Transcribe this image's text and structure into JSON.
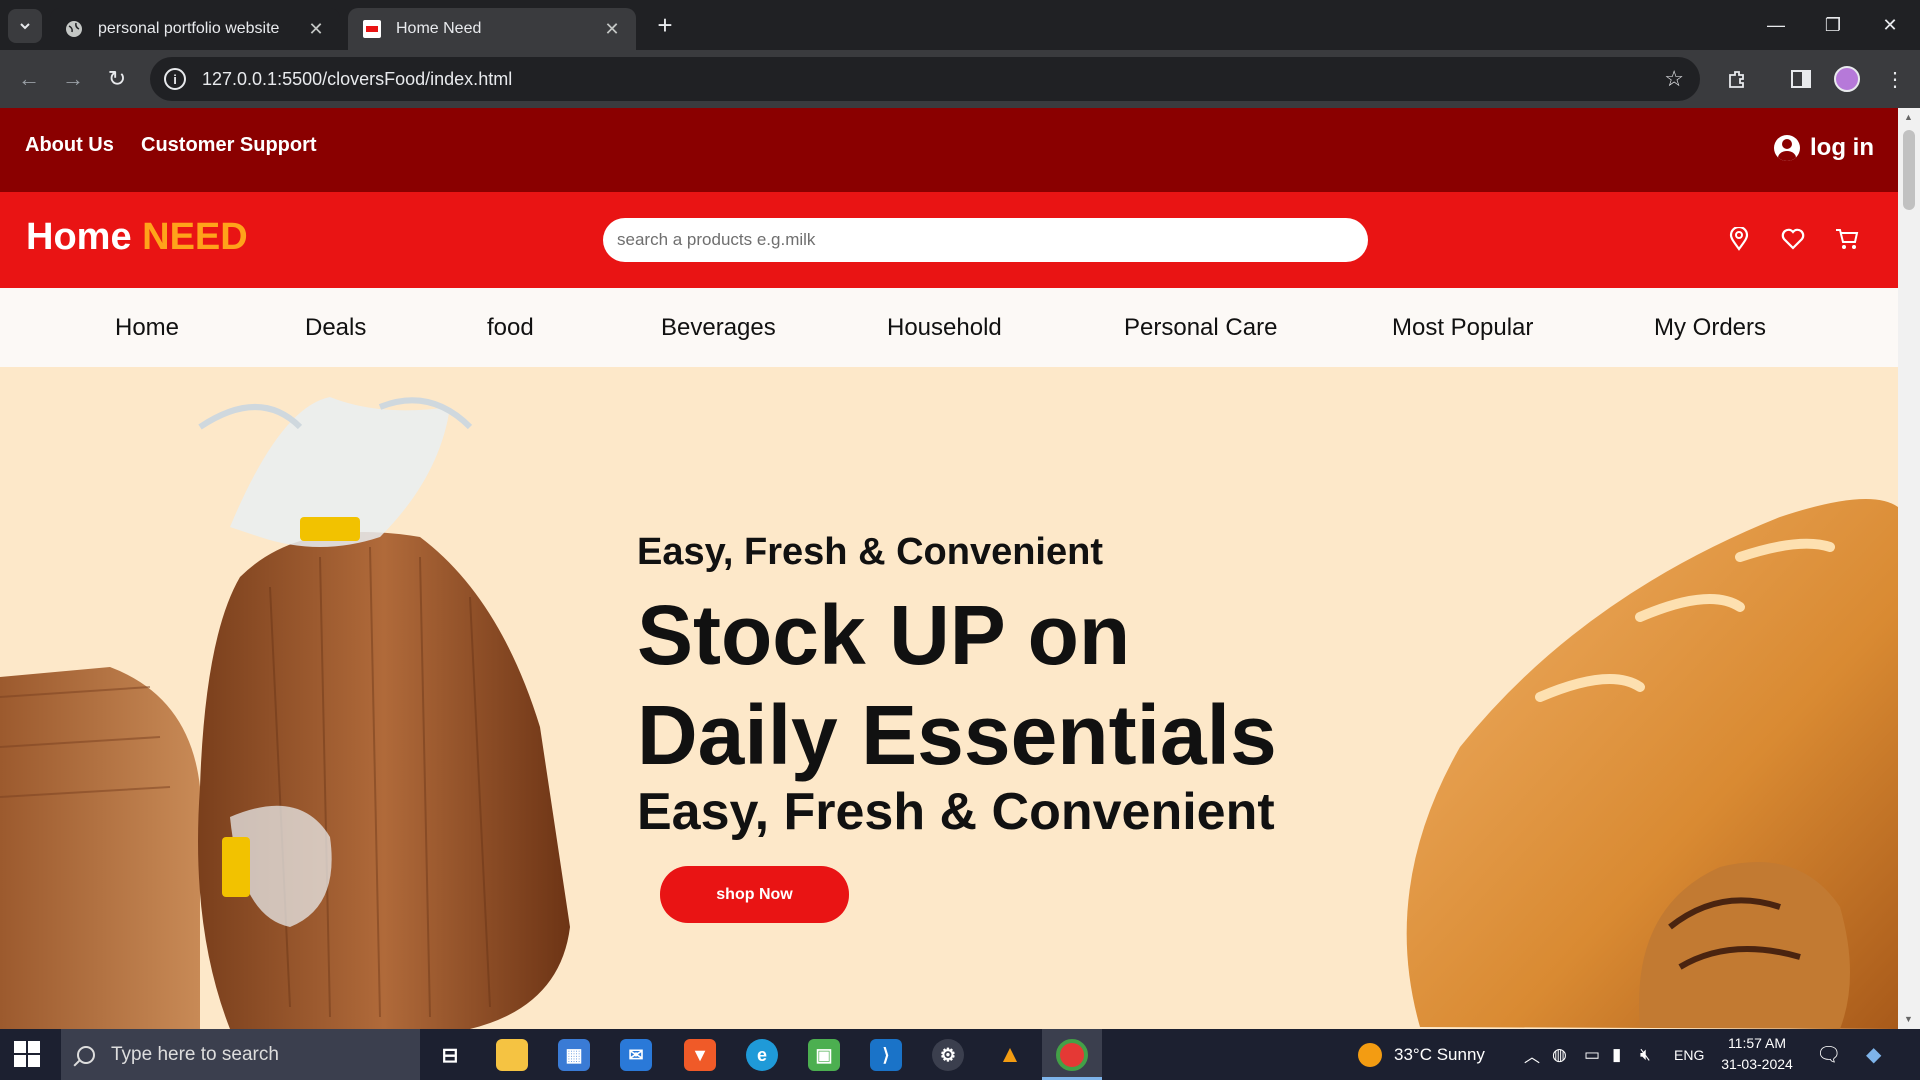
{
  "browser": {
    "tabs": [
      {
        "title": "personal portfolio website",
        "active": false
      },
      {
        "title": "Home Need",
        "active": true
      }
    ],
    "new_tab": "+",
    "url": "127.0.0.1:5500/cloversFood/index.html"
  },
  "site": {
    "topbar": {
      "links": [
        "About Us",
        "Customer Support"
      ],
      "login": "log in"
    },
    "logo": {
      "part1": "Home",
      "part2": "NEED"
    },
    "search_placeholder": "search a products e.g.milk",
    "nav": [
      "Home",
      "Deals",
      "food",
      "Beverages",
      "Household",
      "Personal Care",
      "Most Popular",
      "My Orders"
    ],
    "hero": {
      "tagline": "Easy, Fresh & Convenient",
      "headline_line1": "Stock UP on",
      "headline_line2": "Daily Essentials",
      "subline": "Easy, Fresh & Convenient",
      "cta": "shop Now"
    },
    "colors": {
      "topbar": "#8a0000",
      "header": "#e91414",
      "logo_accent": "#ffa31a",
      "hero_bg": "#fde8c9"
    }
  },
  "taskbar": {
    "search_placeholder": "Type here to search",
    "weather": "33°C  Sunny",
    "language": "ENG",
    "time": "11:57 AM",
    "date": "31-03-2024"
  }
}
